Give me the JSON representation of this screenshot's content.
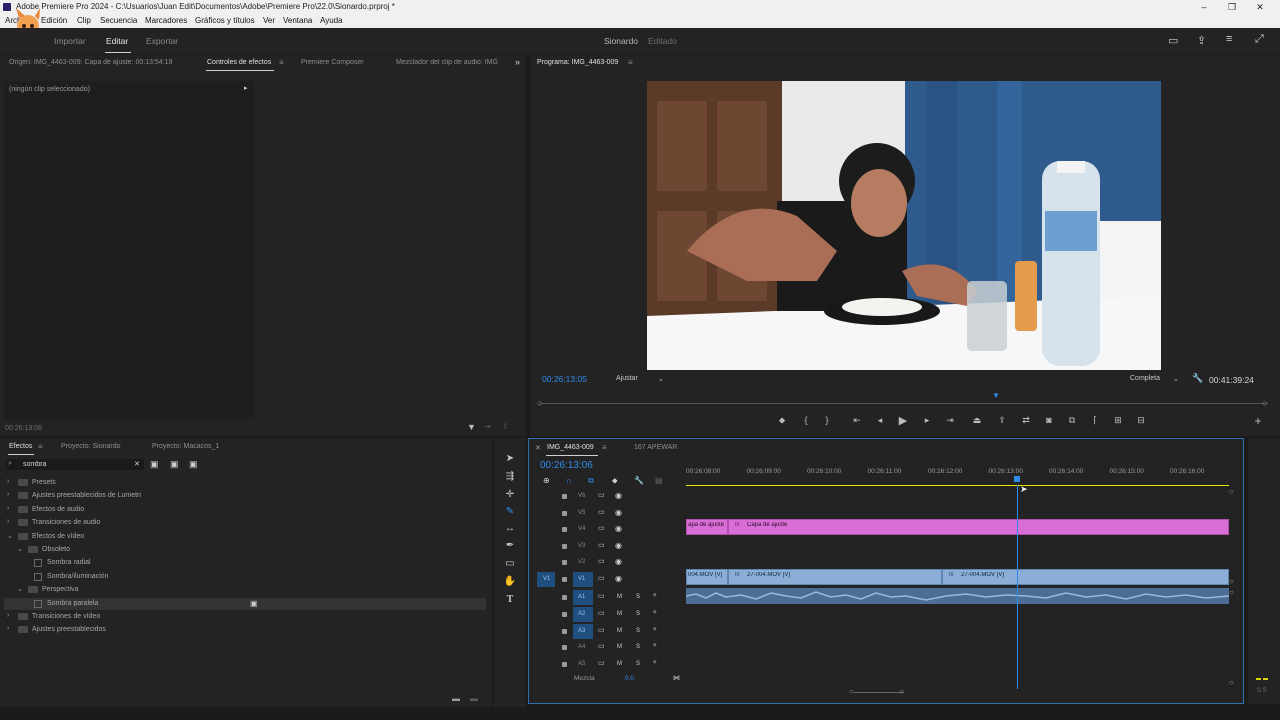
{
  "window": {
    "title": "Adobe Premiere Pro 2024 - C:\\Usuarios\\Juan Edit\\Documentos\\Adobe\\Premiere Pro\\22.0\\Sionardo.prproj *"
  },
  "menu": [
    "Archivo",
    "Edición",
    "Clip",
    "Secuencia",
    "Marcadores",
    "Gráficos y títulos",
    "Ver",
    "Ventana",
    "Ayuda"
  ],
  "workspace": {
    "tabs": [
      "Importar",
      "Editar",
      "Exportar"
    ],
    "active": "Editar",
    "project_name": "Sionardo",
    "project_status": "Editado"
  },
  "source_panel": {
    "tabs": [
      "Origen: IMG_4463-009: Capa de ajuste: 00:13:54:19",
      "Controles de efectos",
      "Premiere Composer",
      "Mezclador del clip de audio: IMG"
    ],
    "active_tab": "Controles de efectos",
    "no_clip": "(ningún clip seleccionado)",
    "timecode": "00:26:13:06"
  },
  "program_panel": {
    "title": "Programa: IMG_4463-009",
    "timecode": "00:26:13:05",
    "fit": "Ajustar",
    "quality": "Completa",
    "duration": "00:41:39:24"
  },
  "effects_panel": {
    "tabs": [
      "Efectos",
      "Proyecto: Sionardo",
      "Proyecto: Macacos_1"
    ],
    "search": "sombra",
    "tree": [
      {
        "label": "Presets",
        "depth": 0,
        "kind": "folder"
      },
      {
        "label": "Ajustes preestablecidos de Lumetri",
        "depth": 0,
        "kind": "folder"
      },
      {
        "label": "Efectos de audio",
        "depth": 0,
        "kind": "folder"
      },
      {
        "label": "Transiciones de audio",
        "depth": 0,
        "kind": "folder"
      },
      {
        "label": "Efectos de vídeo",
        "depth": 0,
        "kind": "folder"
      },
      {
        "label": "Obsoleto",
        "depth": 1,
        "kind": "folder"
      },
      {
        "label": "Sombra radial",
        "depth": 2,
        "kind": "fx"
      },
      {
        "label": "Sombra/iluminación",
        "depth": 2,
        "kind": "fx"
      },
      {
        "label": "Perspectiva",
        "depth": 1,
        "kind": "folder"
      },
      {
        "label": "Sombra paralela",
        "depth": 2,
        "kind": "fx"
      },
      {
        "label": "Transiciones de vídeo",
        "depth": 0,
        "kind": "folder"
      },
      {
        "label": "Ajustes preestablecidos",
        "depth": 0,
        "kind": "folder"
      }
    ]
  },
  "timeline": {
    "tabs": [
      "IMG_4463-009",
      "167 APEWAR"
    ],
    "timecode": "00:26:13:06",
    "ruler": [
      "00:26:08:00",
      "00:26:09:00",
      "00:26:10:00",
      "00:26:11:00",
      "00:26:12:00",
      "00:26:13:00",
      "00:26:14:00",
      "00:26:15:00",
      "00:26:16:00"
    ],
    "video_tracks": [
      "V6",
      "V5",
      "V4",
      "V3",
      "V2",
      "V1"
    ],
    "audio_tracks": [
      "A1",
      "A2",
      "A3",
      "A4",
      "A5"
    ],
    "source_patch_v": "V1",
    "mix_label": "Mezcla",
    "mix_value": "0,0",
    "m_label": "M",
    "s_label": "S",
    "clips": {
      "adj_a": "apa de ajuste",
      "adj_b": "Capa de ajuste",
      "v1_a": "004.MOV [V]",
      "v1_b": "27-004.MOV [V]",
      "v1_c": "27-004.MOV [V]"
    },
    "meter_label": "S S"
  },
  "colors": {
    "accent": "#2d8ceb",
    "adjustment_clip": "#d96fd6",
    "video_clip": "#8aaed6",
    "audio_clip": "#4c6e96"
  }
}
